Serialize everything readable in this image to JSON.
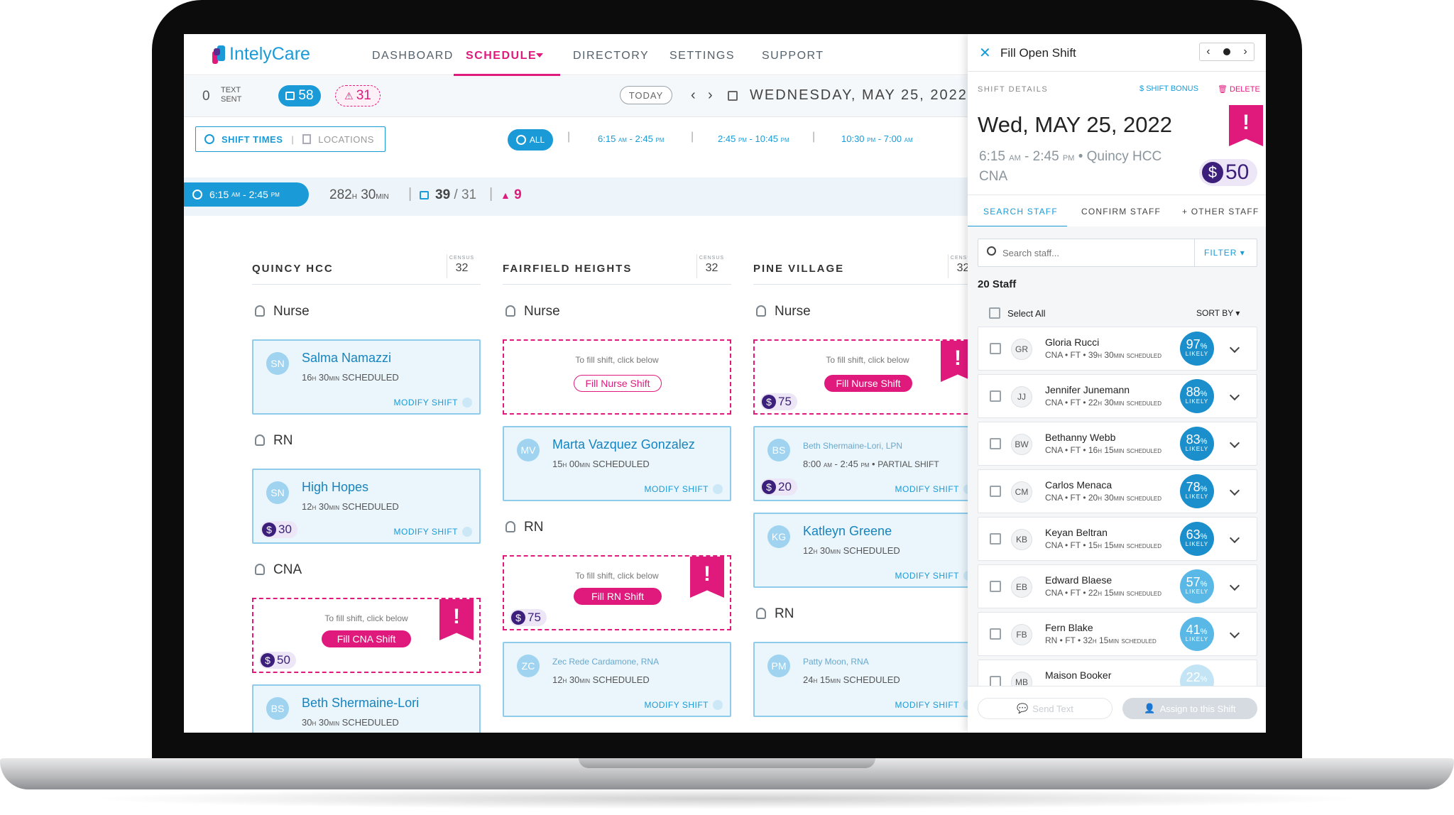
{
  "app": {
    "brand": "IntelyCare"
  },
  "nav": {
    "items": [
      "DASHBOARD",
      "SCHEDULE",
      "DIRECTORY",
      "SETTINGS",
      "SUPPORT"
    ],
    "active": "SCHEDULE"
  },
  "subbar": {
    "text_count": "0",
    "text_label1": "TEXT",
    "text_label2": "SENT",
    "calendar_count": "58",
    "alert_count": "31",
    "today": "TODAY",
    "date": "WEDNESDAY, MAY 25, 2022"
  },
  "filters": {
    "shift_times": "SHIFT TIMES",
    "locations": "LOCATIONS",
    "all": "ALL",
    "times": [
      {
        "a": "6:15",
        "ap": "AM",
        "b": "2:45",
        "bp": "PM"
      },
      {
        "a": "2:45",
        "ap": "PM",
        "b": "10:45",
        "bp": "PM"
      },
      {
        "a": "10:30",
        "ap": "PM",
        "b": "7:00",
        "bp": "AM"
      }
    ]
  },
  "shift_summary": {
    "time_a": "6:15",
    "time_a_ap": "AM",
    "time_b": "2:45",
    "time_b_ap": "PM",
    "hours": "282",
    "h": "H",
    "mins": "30",
    "min": "MIN",
    "filled": "39",
    "total": "/ 31",
    "alerts": "9"
  },
  "columns": [
    {
      "name": "QUINCY HCC",
      "census_label": "CENSUS",
      "census": "32"
    },
    {
      "name": "FAIRFIELD HEIGHTS",
      "census_label": "CENSUS",
      "census": "32"
    },
    {
      "name": "PINE VILLAGE",
      "census_label": "CENSUS",
      "census": "32"
    }
  ],
  "roles": {
    "nurse": "Nurse",
    "rn": "RN",
    "cna": "CNA"
  },
  "common": {
    "modify": "MODIFY SHIFT",
    "hint": "To fill shift, click below",
    "scheduled": "SCHEDULED"
  },
  "cards": {
    "salma": {
      "ini": "SN",
      "name": "Salma Namazzi",
      "h": "16",
      "m": "30"
    },
    "high": {
      "ini": "SN",
      "name": "High Hopes",
      "h": "12",
      "m": "30",
      "bonus": "30"
    },
    "beth1": {
      "ini": "BS",
      "name": "Beth Shermaine-Lori",
      "h": "30",
      "m": "30"
    },
    "marta": {
      "ini": "MV",
      "name": "Marta Vazquez Gonzalez",
      "h": "15",
      "m": "00"
    },
    "zec": {
      "ini": "ZC",
      "name": "Zec Rede Cardamone",
      "suffix": ", RNA",
      "h": "12",
      "m": "30"
    },
    "beth2": {
      "ini": "BS",
      "name": "Beth Shermaine-Lori",
      "suffix": ", LPN",
      "time": "8:00",
      "time_ap": "AM",
      "time2": "2:45",
      "time2_ap": "PM",
      "partial": "PARTIAL SHIFT",
      "bonus": "20"
    },
    "katleyn": {
      "ini": "KG",
      "name": "Katleyn Greene",
      "h": "12",
      "m": "30"
    },
    "patty": {
      "ini": "PM",
      "name": "Patty Moon",
      "suffix": ", RNA",
      "h": "24",
      "m": "15"
    }
  },
  "open": {
    "cna": {
      "btn": "Fill CNA Shift",
      "bonus": "50"
    },
    "nurse_ff": {
      "btn": "Fill Nurse Shift"
    },
    "rn_ff": {
      "btn": "Fill RN Shift",
      "bonus": "75"
    },
    "nurse_pv": {
      "btn": "Fill Nurse Shift",
      "bonus": "75"
    }
  },
  "panel": {
    "title": "Fill Open Shift",
    "details": "SHIFT DETAILS",
    "shift_bonus": "SHIFT BONUS",
    "delete": "DELETE",
    "date": "Wed, MAY 25, 2022",
    "time_a": "6:15",
    "time_a_ap": "AM",
    "time_b": "2:45",
    "time_b_ap": "PM",
    "location": "• Quincy HCC",
    "role": "CNA",
    "bonus": "50",
    "tabs": [
      "SEARCH STAFF",
      "CONFIRM STAFF",
      "+ OTHER STAFF"
    ],
    "search_placeholder": "Search staff...",
    "filter": "FILTER",
    "count": "20 Staff",
    "select_all": "Select All",
    "sort_by": "SORT BY",
    "staff": [
      {
        "ini": "GR",
        "name": "Gloria Rucci",
        "role": "CNA • FT • 39",
        "m": "30",
        "pct": "97"
      },
      {
        "ini": "JJ",
        "name": "Jennifer Junemann",
        "role": "CNA • FT • 22",
        "m": "30",
        "pct": "88"
      },
      {
        "ini": "BW",
        "name": "Bethanny Webb",
        "role": "CNA • FT • 16",
        "m": "15",
        "pct": "83"
      },
      {
        "ini": "CM",
        "name": "Carlos Menaca",
        "role": "CNA • FT • 20",
        "m": "30",
        "pct": "78"
      },
      {
        "ini": "KB",
        "name": "Keyan Beltran",
        "role": "CNA • FT • 15",
        "m": "15",
        "pct": "63"
      },
      {
        "ini": "EB",
        "name": "Edward Blaese",
        "role": "CNA • FT • 22",
        "m": "15",
        "pct": "57"
      },
      {
        "ini": "FB",
        "name": "Fern Blake",
        "role": "RN • FT • 32",
        "m": "15",
        "pct": "41"
      },
      {
        "ini": "MB",
        "name": "Maison Booker",
        "role": "",
        "m": "",
        "pct": "22"
      }
    ],
    "likely": "LIKELY",
    "h": "H",
    "min": "MIN",
    "scheduled": "SCHEDULED",
    "send": "Send Text",
    "assign": "Assign to this Shift"
  },
  "colors": {
    "brand": "#1a9bd7",
    "accent": "#e0197d",
    "bonus": "#3b1f7a"
  }
}
